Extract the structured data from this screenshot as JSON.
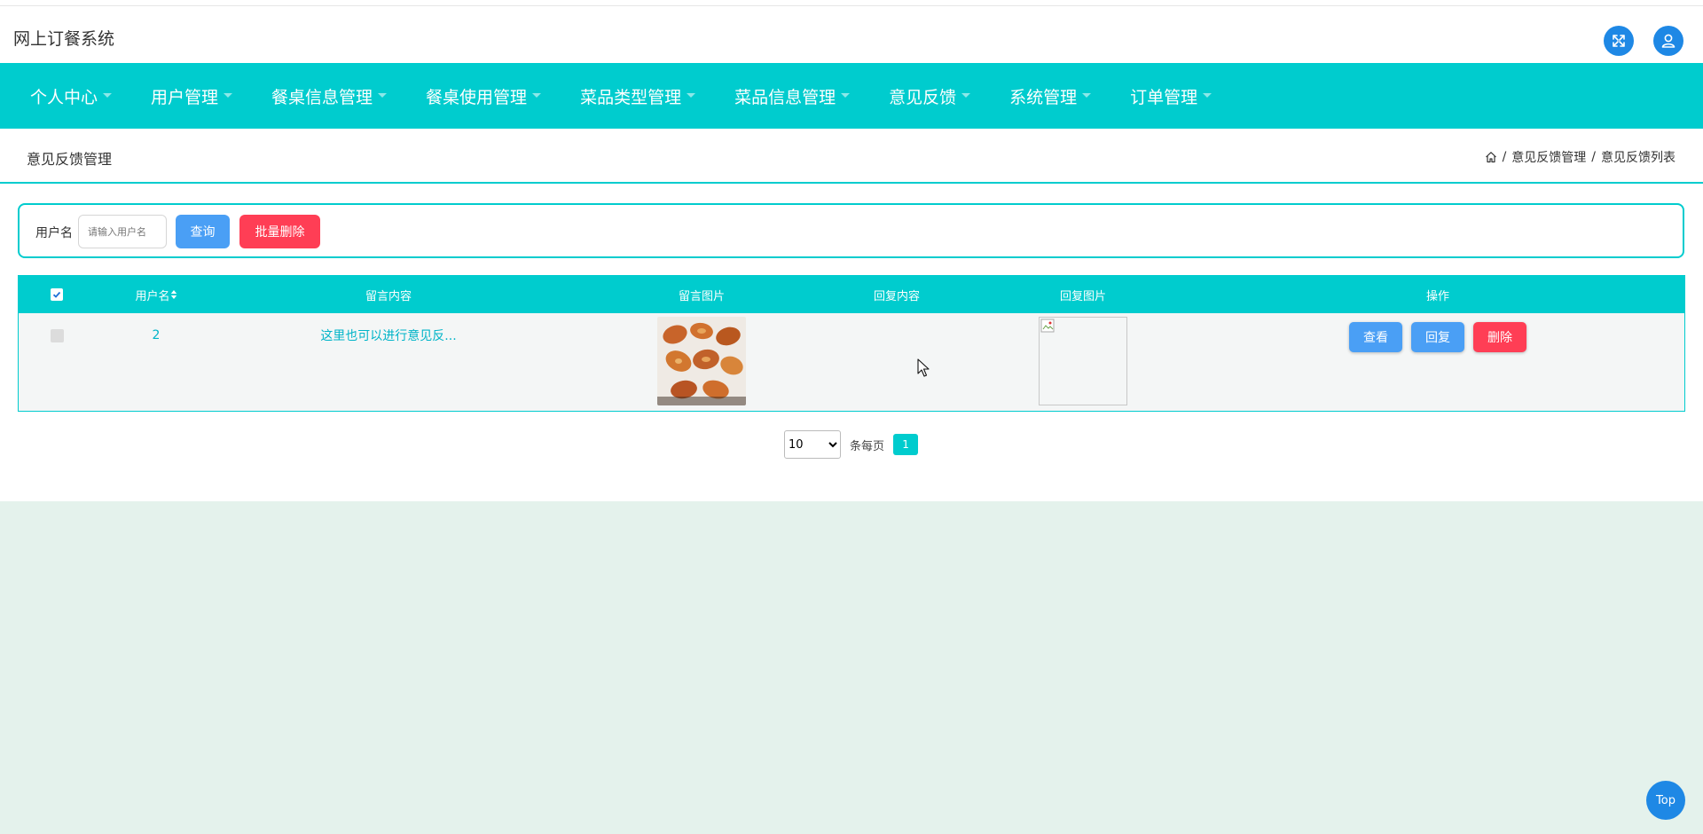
{
  "app": {
    "title": "网上订餐系统"
  },
  "nav": {
    "items": [
      "个人中心",
      "用户管理",
      "餐桌信息管理",
      "餐桌使用管理",
      "菜品类型管理",
      "菜品信息管理",
      "意见反馈",
      "系统管理",
      "订单管理"
    ]
  },
  "page": {
    "title": "意见反馈管理",
    "breadcrumb": [
      "意见反馈管理",
      "意见反馈列表"
    ],
    "breadcrumb_sep": "/"
  },
  "search": {
    "label": "用户名",
    "placeholder": "请输入用户名",
    "query_label": "查询",
    "batch_delete_label": "批量删除"
  },
  "table": {
    "headers": [
      "用户名",
      "留言内容",
      "留言图片",
      "回复内容",
      "回复图片",
      "操作"
    ],
    "sort_icon": "sort-icon",
    "rows": [
      {
        "username": "2",
        "content": "这里也可以进行意见反...",
        "reply": "",
        "actions": [
          "查看",
          "回复",
          "删除"
        ]
      }
    ]
  },
  "pagination": {
    "page_size": "10",
    "page_size_options": [
      "10"
    ],
    "per_page_label": "条每页",
    "current_page": "1"
  },
  "back_to_top": "Top",
  "colors": {
    "accent": "#00ccce",
    "primary_blue": "#4a9ff5",
    "danger": "#ff3e55",
    "page_bg": "#e4f2ec"
  }
}
